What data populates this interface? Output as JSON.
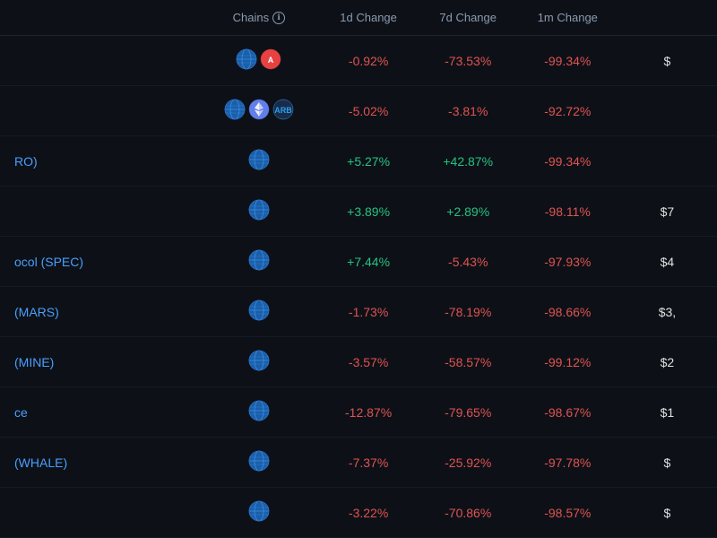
{
  "header": {
    "chains_label": "Chains",
    "info_icon": "ℹ",
    "col_1d": "1d Change",
    "col_7d": "7d Change",
    "col_1m": "1m Change"
  },
  "rows": [
    {
      "name": "",
      "chains": [
        "globe",
        "avax"
      ],
      "change_1d": "-0.92%",
      "change_1d_type": "negative",
      "change_7d": "-73.53%",
      "change_7d_type": "negative",
      "change_1m": "-99.34%",
      "change_1m_type": "negative",
      "extra": "$"
    },
    {
      "name": "",
      "chains": [
        "globe",
        "eth",
        "arb"
      ],
      "change_1d": "-5.02%",
      "change_1d_type": "negative",
      "change_7d": "-3.81%",
      "change_7d_type": "negative",
      "change_1m": "-92.72%",
      "change_1m_type": "negative",
      "extra": ""
    },
    {
      "name": "RO)",
      "chains": [
        "globe"
      ],
      "change_1d": "+5.27%",
      "change_1d_type": "positive",
      "change_7d": "+42.87%",
      "change_7d_type": "positive",
      "change_1m": "-99.34%",
      "change_1m_type": "negative",
      "extra": ""
    },
    {
      "name": "",
      "chains": [
        "globe"
      ],
      "change_1d": "+3.89%",
      "change_1d_type": "positive",
      "change_7d": "+2.89%",
      "change_7d_type": "positive",
      "change_1m": "-98.11%",
      "change_1m_type": "negative",
      "extra": "$7"
    },
    {
      "name": "ocol (SPEC)",
      "chains": [
        "globe"
      ],
      "change_1d": "+7.44%",
      "change_1d_type": "positive",
      "change_7d": "-5.43%",
      "change_7d_type": "negative",
      "change_1m": "-97.93%",
      "change_1m_type": "negative",
      "extra": "$4"
    },
    {
      "name": "(MARS)",
      "chains": [
        "globe"
      ],
      "change_1d": "-1.73%",
      "change_1d_type": "negative",
      "change_7d": "-78.19%",
      "change_7d_type": "negative",
      "change_1m": "-98.66%",
      "change_1m_type": "negative",
      "extra": "$3,"
    },
    {
      "name": "(MINE)",
      "chains": [
        "globe"
      ],
      "change_1d": "-3.57%",
      "change_1d_type": "negative",
      "change_7d": "-58.57%",
      "change_7d_type": "negative",
      "change_1m": "-99.12%",
      "change_1m_type": "negative",
      "extra": "$2"
    },
    {
      "name": "ce",
      "chains": [
        "globe"
      ],
      "change_1d": "-12.87%",
      "change_1d_type": "negative",
      "change_7d": "-79.65%",
      "change_7d_type": "negative",
      "change_1m": "-98.67%",
      "change_1m_type": "negative",
      "extra": "$1"
    },
    {
      "name": "(WHALE)",
      "chains": [
        "globe"
      ],
      "change_1d": "-7.37%",
      "change_1d_type": "negative",
      "change_7d": "-25.92%",
      "change_7d_type": "negative",
      "change_1m": "-97.78%",
      "change_1m_type": "negative",
      "extra": "$"
    },
    {
      "name": "",
      "chains": [
        "globe"
      ],
      "change_1d": "-3.22%",
      "change_1d_type": "negative",
      "change_7d": "-70.86%",
      "change_7d_type": "negative",
      "change_1m": "-98.57%",
      "change_1m_type": "negative",
      "extra": "$"
    }
  ]
}
